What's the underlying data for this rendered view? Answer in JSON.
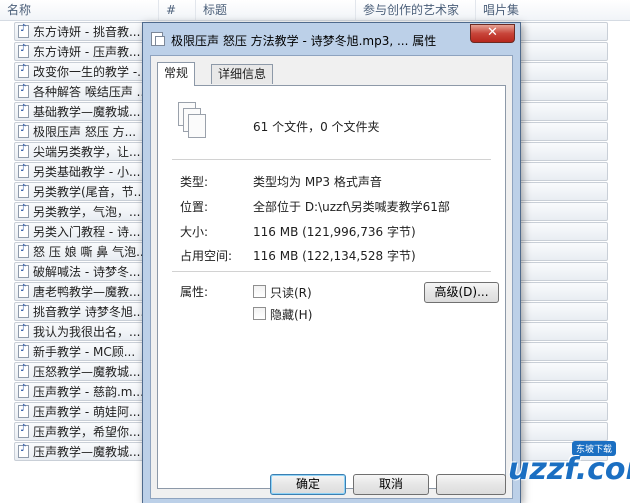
{
  "columns": {
    "name": "名称",
    "number": "#",
    "title": "标题",
    "artist": "参与创作的艺术家",
    "album": "唱片集"
  },
  "files": [
    "东方诗妍 - 挑音教...",
    "东方诗妍 - 压声教...",
    "改变你一生的教学 -...",
    "各种解答 喉结压声 ...",
    "基础教学—魔教城...",
    "极限压声 怒压 方...",
    "尖端另类教学，让...",
    "另类基础教学 - 小...",
    "另类教学(尾音，节...",
    "另类教学，气泡，...",
    "另类入门教程 - 诗...",
    "怒 压 娘 嘶 鼻 气泡...",
    "破解喊法 - 诗梦冬...",
    "唐老鸭教学—魔教...",
    "挑音教学 诗梦冬旭...",
    "我认为我很出名，...",
    "新手教学 - MC顾...",
    "压怒教学—魔教城...",
    "压声教学 - 慈韵.m...",
    "压声教学 - 萌娃阿...",
    "压声教学，希望你...",
    "压声教学—魔教城..."
  ],
  "dialog": {
    "title": "极限压声 怒压 方法教学 - 诗梦冬旭.mp3, ... 属性",
    "close_glyph": "✕",
    "tabs": [
      "常规",
      "详细信息"
    ],
    "summary": "61 个文件，0 个文件夹",
    "type_label": "类型:",
    "type_value": "类型均为 MP3 格式声音",
    "location_label": "位置:",
    "location_value": "全部位于 D:\\uzzf\\另类喊麦教学61部",
    "size_label": "大小:",
    "size_value": "116 MB (121,996,736 字节)",
    "disk_label": "占用空间:",
    "disk_value": "116 MB (122,134,528 字节)",
    "attributes_label": "属性:",
    "readonly_label": "只读(R)",
    "hidden_label": "隐藏(H)",
    "advanced_button": "高级(D)...",
    "ok_button": "确定",
    "cancel_button": "取消"
  },
  "watermark": {
    "brand": "uzzf.com",
    "tag": "东坡下载"
  }
}
